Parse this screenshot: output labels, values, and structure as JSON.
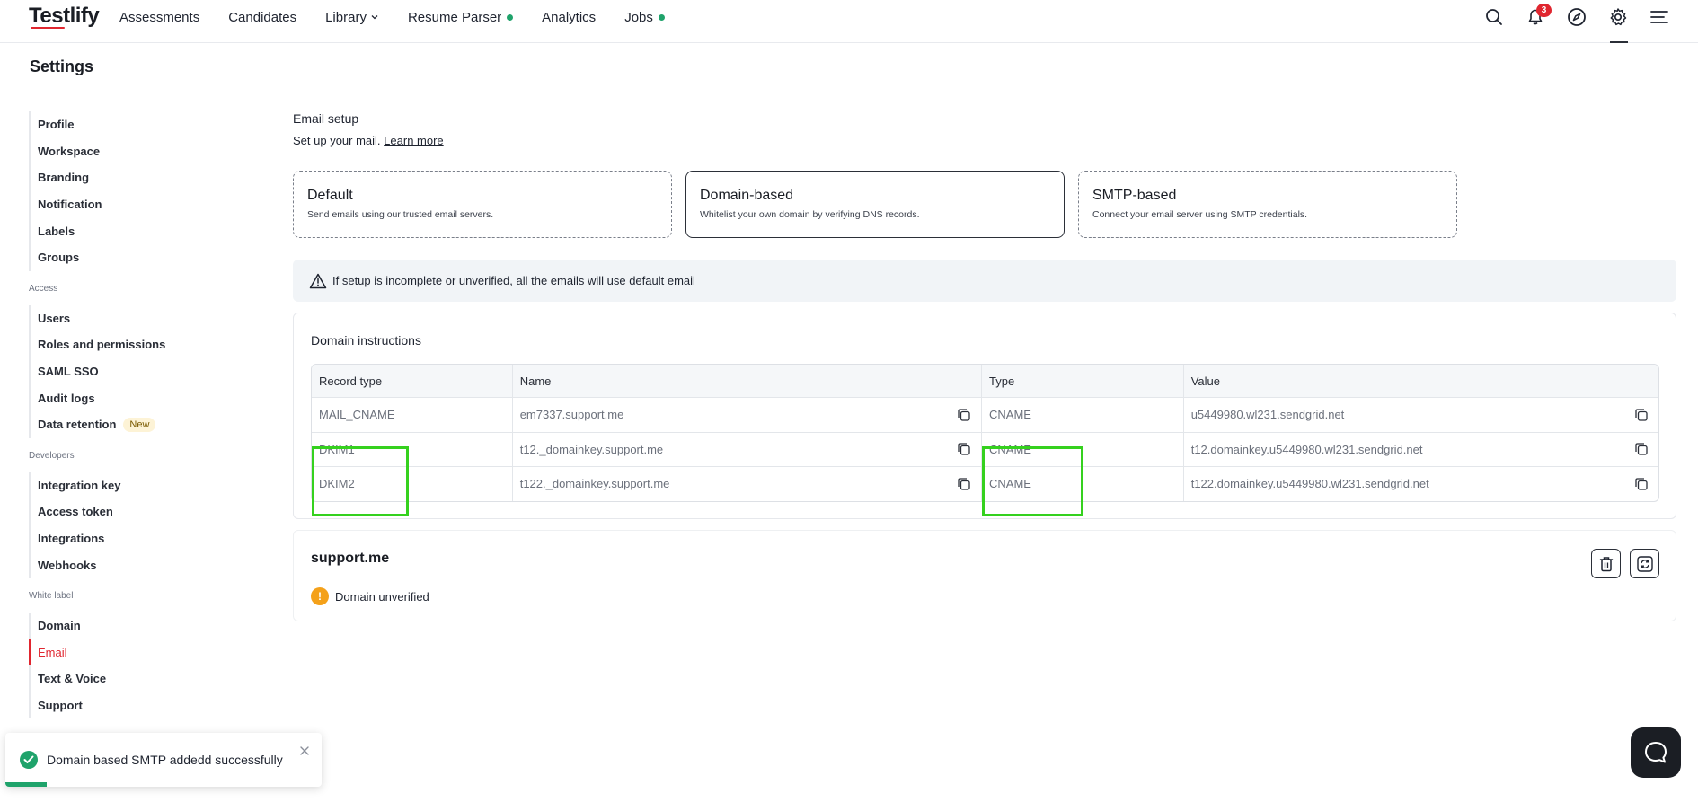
{
  "app": {
    "logo": "Testlify",
    "nav": [
      {
        "label": "Assessments"
      },
      {
        "label": "Candidates"
      },
      {
        "label": "Library"
      },
      {
        "label": "Resume Parser"
      },
      {
        "label": "Analytics"
      },
      {
        "label": "Jobs"
      }
    ],
    "notifications_count": "3",
    "icons": [
      "search-icon",
      "bell-icon",
      "compass-icon",
      "gear-icon",
      "menu-icon"
    ],
    "accent_color": "#e0262f",
    "success_color": "#1fa36b"
  },
  "page": {
    "title": "Settings"
  },
  "sidebar": {
    "groups": [
      {
        "items": [
          "Profile",
          "Workspace",
          "Branding",
          "Notification",
          "Labels",
          "Groups"
        ]
      },
      {
        "section": "Access",
        "items": [
          "Users",
          "Roles and permissions",
          "SAML SSO",
          "Audit logs",
          "Data retention"
        ],
        "badge": "New"
      },
      {
        "section": "Developers",
        "items": [
          "Integration key",
          "Access token",
          "Integrations",
          "Webhooks"
        ]
      },
      {
        "section": "White label",
        "items": [
          "Domain",
          "Email",
          "Text & Voice",
          "Support"
        ],
        "active": "Email"
      }
    ]
  },
  "email_setup": {
    "heading": "Email setup",
    "subtitle": "Set up your mail.",
    "learn_more": "Learn more",
    "options": [
      {
        "title": "Default",
        "desc": "Send emails using our trusted email servers."
      },
      {
        "title": "Domain-based",
        "desc": "Whitelist your own domain by verifying DNS records.",
        "selected": true
      },
      {
        "title": "SMTP-based",
        "desc": "Connect your email server using SMTP credentials."
      }
    ],
    "notice": "If setup is incomplete or unverified, all the emails will use default email"
  },
  "instructions": {
    "title": "Domain instructions",
    "columns": [
      "Record type",
      "Name",
      "Type",
      "Value"
    ],
    "rows": [
      {
        "record_type": "MAIL_CNAME",
        "name": "em7337.support.me",
        "type": "CNAME",
        "value": "u5449980.wl231.sendgrid.net"
      },
      {
        "record_type": "DKIM1",
        "name": "t12._domainkey.support.me",
        "type": "CNAME",
        "value": "t12.domainkey.u5449980.wl231.sendgrid.net"
      },
      {
        "record_type": "DKIM2",
        "name": "t122._domainkey.support.me",
        "type": "CNAME",
        "value": "t122.domainkey.u5449980.wl231.sendgrid.net"
      }
    ]
  },
  "domain": {
    "name": "support.me",
    "status": "Domain unverified",
    "status_icon": "!"
  },
  "toast": {
    "message": "Domain based SMTP addedd successfully",
    "progress": 0.13
  }
}
